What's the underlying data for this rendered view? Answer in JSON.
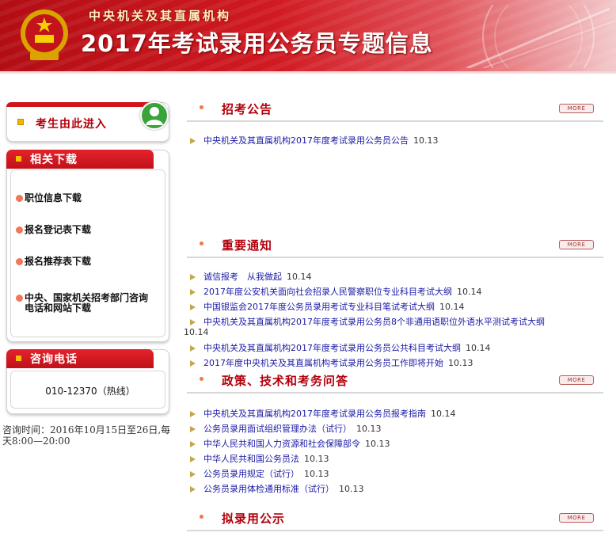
{
  "banner": {
    "subtitle": "中央机关及其直属机构",
    "title": "2017年考试录用公务员专题信息"
  },
  "sidebar": {
    "entry_label": "考生由此进入",
    "downloads_title": "相关下载",
    "downloads": [
      {
        "label": "职位信息下载"
      },
      {
        "label": "报名登记表下载"
      },
      {
        "label": "报名推荐表下载"
      },
      {
        "label": "中央、国家机关招考部门咨询电话和网站下载"
      }
    ],
    "hotline_title": "咨询电话",
    "hotline": "010-12370（热线）",
    "consult_time": "咨询时间：2016年10月15日至26日,每天8:00—20:00"
  },
  "more_label": "MORE",
  "sections": [
    {
      "title": "招考公告",
      "items": [
        {
          "text": "中央机关及其直属机构2017年度考试录用公务员公告",
          "date": "10.13"
        }
      ]
    },
    {
      "title": "重要通知",
      "items": [
        {
          "text": "诚信报考　从我做起",
          "date": "10.14"
        },
        {
          "text": "2017年度公安机关面向社会招录人民警察职位专业科目考试大纲",
          "date": "10.14"
        },
        {
          "text": "中国银监会2017年度公务员录用考试专业科目笔试考试大纲",
          "date": "10.14"
        },
        {
          "text": "中央机关及其直属机构2017年度考试录用公务员8个非通用语职位外语水平测试考试大纲",
          "date": "10.14"
        },
        {
          "text": "中央机关及其直属机构2017年度考试录用公务员公共科目考试大纲",
          "date": "10.14"
        },
        {
          "text": "2017年度中央机关及其直属机构考试录用公务员工作即将开始",
          "date": "10.13"
        }
      ]
    },
    {
      "title": "政策、技术和考务问答",
      "items": [
        {
          "text": "中央机关及其直属机构2017年度考试录用公务员报考指南",
          "date": "10.14"
        },
        {
          "text": "公务员录用面试组织管理办法（试行）",
          "date": "10.13"
        },
        {
          "text": "中华人民共和国人力资源和社会保障部令",
          "date": "10.13"
        },
        {
          "text": "中华人民共和国公务员法",
          "date": "10.13"
        },
        {
          "text": "公务员录用规定（试行）",
          "date": "10.13"
        },
        {
          "text": "公务员录用体检通用标准（试行）",
          "date": "10.13"
        }
      ]
    },
    {
      "title": "拟录用公示",
      "items": []
    }
  ],
  "colors": {
    "accent": "#b3000b",
    "banner_red": "#d11a22",
    "link": "#1a1aa6",
    "bullet_orange": "#f07a3c"
  },
  "icons": [
    "national-emblem-icon",
    "user-icon",
    "triangle-bullet-icon",
    "more-icon"
  ]
}
